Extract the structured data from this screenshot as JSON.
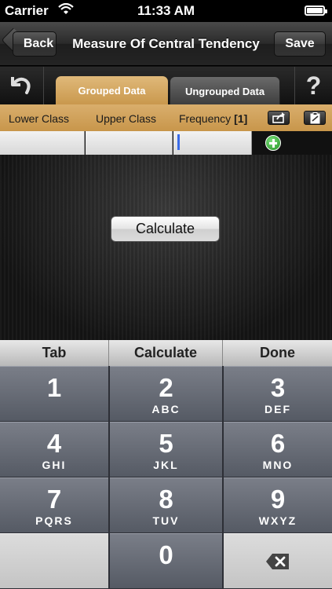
{
  "status_bar": {
    "carrier": "Carrier",
    "time": "11:33 AM"
  },
  "nav": {
    "title": "Measure Of Central Tendency",
    "back_label": "Back",
    "save_label": "Save"
  },
  "tabs": {
    "grouped_label": "Grouped Data",
    "ungrouped_label": "Ungrouped Data",
    "help_label": "?"
  },
  "columns": {
    "lower": "Lower Class",
    "upper": "Upper Class",
    "frequency": "Frequency",
    "frequency_count": "[1]"
  },
  "main": {
    "calculate_label": "Calculate"
  },
  "keypad_toolbar": {
    "tab_label": "Tab",
    "calculate_label": "Calculate",
    "done_label": "Done"
  },
  "keys": [
    {
      "num": "1",
      "letters": ""
    },
    {
      "num": "2",
      "letters": "ABC"
    },
    {
      "num": "3",
      "letters": "DEF"
    },
    {
      "num": "4",
      "letters": "GHI"
    },
    {
      "num": "5",
      "letters": "JKL"
    },
    {
      "num": "6",
      "letters": "MNO"
    },
    {
      "num": "7",
      "letters": "PQRS"
    },
    {
      "num": "8",
      "letters": "TUV"
    },
    {
      "num": "9",
      "letters": "WXYZ"
    },
    {
      "num": "0",
      "letters": ""
    }
  ],
  "colors": {
    "accent_tab": "#d4a45e",
    "cursor": "#3a6be8"
  }
}
